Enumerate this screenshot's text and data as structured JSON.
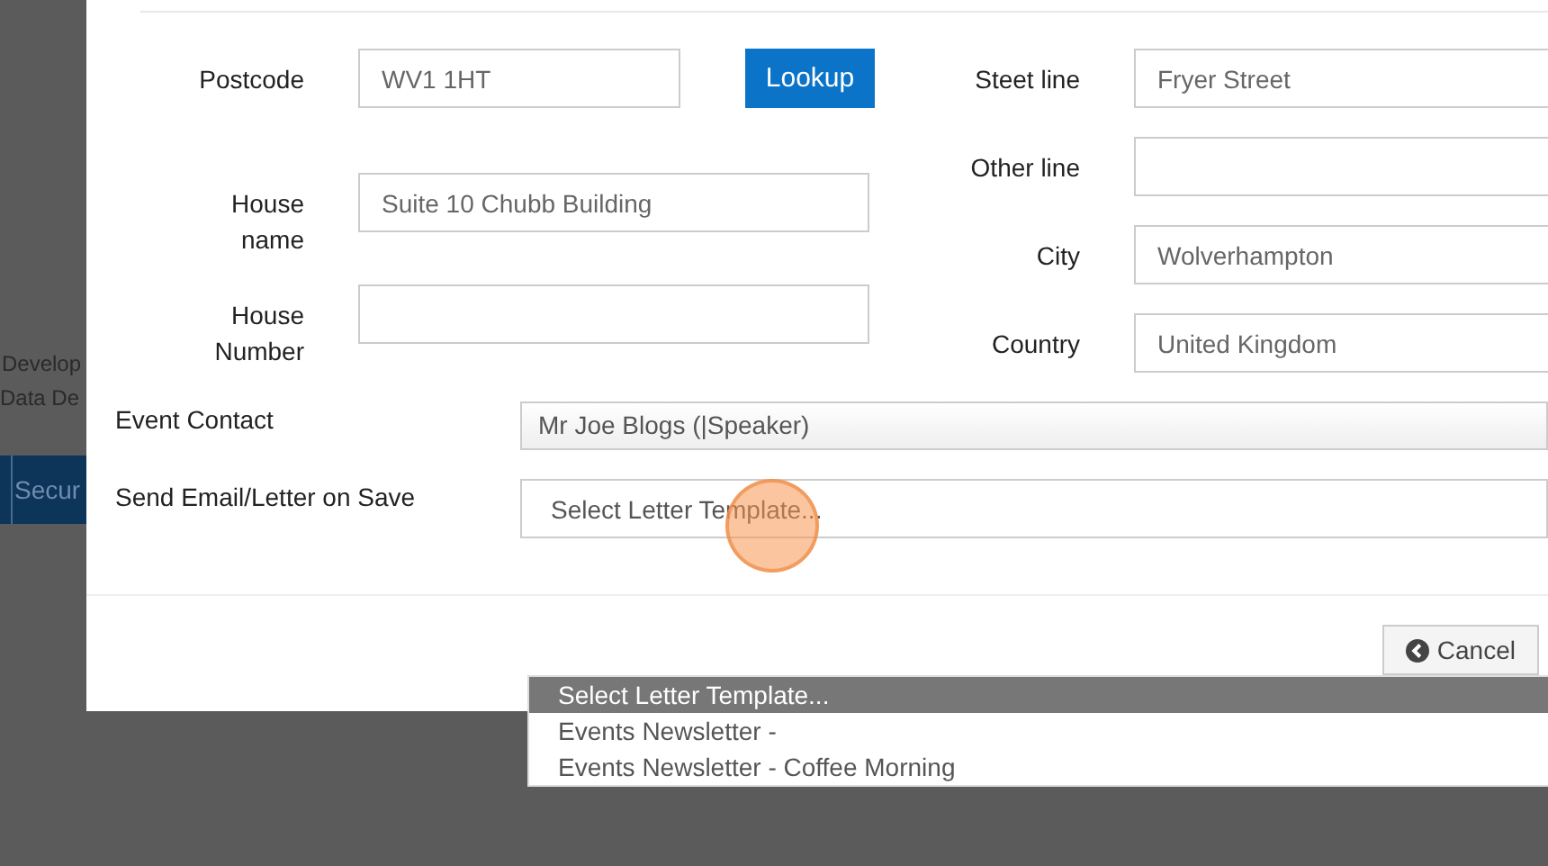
{
  "background": {
    "texts": [
      "Develop",
      "Data De"
    ],
    "nav_item": "Secur"
  },
  "address": {
    "left_fields": [
      {
        "label": "Postcode",
        "value": "WV1 1HT",
        "kind": "lookup"
      },
      {
        "label": "House name",
        "value": "Suite 10 Chubb Building",
        "kind": "text"
      },
      {
        "label": "House Number",
        "kind": "text"
      }
    ],
    "lookup_button": "Lookup",
    "right_fields": [
      {
        "label": "Steet line",
        "value": "Fryer Street"
      },
      {
        "label": "Other line"
      },
      {
        "label": "City",
        "value": "Wolverhampton"
      },
      {
        "label": "Country",
        "value": "United Kingdom"
      }
    ]
  },
  "event_contact": {
    "label": "Event Contact",
    "value": "Mr Joe Blogs (|Speaker)"
  },
  "send_letter": {
    "label": "Send Email/Letter on Save",
    "value": "Select Letter Template..."
  },
  "cancel_button": "Cancel",
  "dropdown": {
    "options": [
      {
        "label": "Select Letter Template...",
        "selected": true
      },
      {
        "label": "Events Newsletter -",
        "selected": false
      },
      {
        "label": "Events Newsletter - Coffee Morning",
        "selected": false
      }
    ]
  }
}
